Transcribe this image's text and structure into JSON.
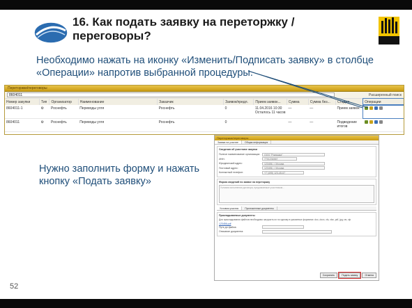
{
  "slide": {
    "title": "16. Как подать заявку на переторжку / переговоры?",
    "instruction_top": "Необходимо нажать на иконку «Изменить/Подписать заявку» в столбце «Операции» напротив выбранной процедуры.",
    "instruction_form": "Нужно заполнить форму и нажать кнопку «Подать заявку»",
    "page_number": "52"
  },
  "list_screen": {
    "header_title": "Переторжки/переговоры",
    "search_value": "8604011",
    "extended_search": "Расширенный поиск",
    "columns": [
      "Номер закупки",
      "Тип",
      "Организатор",
      "Наименование",
      "Заказчик",
      "Заявок/предл.",
      "Прием заявок...",
      "Сумма",
      "Сумма без...",
      "Стадия",
      "Операции"
    ],
    "rows": [
      {
        "number": "8604011-1",
        "org": "Роснефть",
        "name": "Переводы угля",
        "customer": "Роснефть",
        "bids": "0",
        "deadline": "11.04.2016 10:30 Осталось 11 часов",
        "sum": "—",
        "sum_no_vat": "—",
        "stage": "Прием заявок"
      },
      {
        "number": "8604011",
        "org": "Роснефть",
        "name": "Переводы угля",
        "customer": "Роснефть",
        "bids": "0",
        "deadline": "",
        "sum": "—",
        "sum_no_vat": "—",
        "stage": "Подведение итогов"
      }
    ]
  },
  "form_screen": {
    "header_title": "Переторжка/переговоры",
    "tabs": [
      "Заявка на участие",
      "Общая информация"
    ],
    "section_info": "Сведения об участнике закупки",
    "fields": [
      {
        "label": "Полное наименование организации:",
        "value": "ООО \"Ромашка\""
      },
      {
        "label": "ИНН:",
        "value": "7701234567"
      },
      {
        "label": "Юридический адрес:",
        "value": "123456, г. Москва"
      },
      {
        "label": "Почтовый адрес:",
        "value": "123456, г. Москва"
      },
      {
        "label": "Контактный телефон:",
        "value": "+7 (495) 123-45-67"
      }
    ],
    "section_price": "Форма сведений по заявке на переторжку",
    "textarea_text": "Условия исполнения договора, предлагаемые участником...",
    "docs_tabs": [
      "Условия участия",
      "Приложенные документы"
    ],
    "section_docs": "Прикладываемые документы",
    "docs_hint": "Для прикладывания файлов необходимо загрузить их по одному в указанных форматах: doc, docx, xls, xlsx, pdf, jpg, rar, zip",
    "doc_file": "123456.pdf",
    "doc_sign_label": "Путь до файла:",
    "doc_comment_label": "Описание документа:",
    "btn_save": "Сохранить",
    "btn_submit": "Подать заявку",
    "btn_cancel": "Отмена"
  },
  "colors": {
    "accent": "#1f4e79",
    "header_gold": "#d9ae2a",
    "highlight": "#4a7fbf",
    "submit_outline": "#dd3333"
  }
}
